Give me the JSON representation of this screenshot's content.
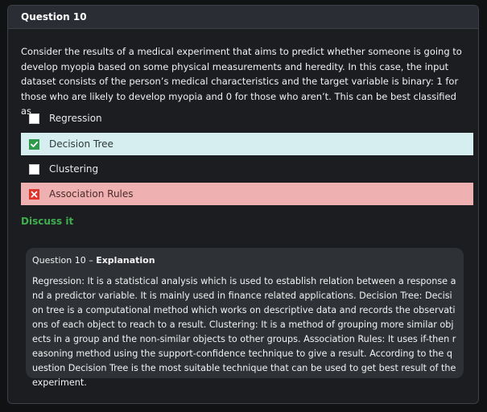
{
  "card": {
    "title": "Question 10"
  },
  "question": {
    "text": "Consider the results of a medical experiment that aims to predict whether someone is going to develop myopia based on some physical measurements and heredity. In this case, the input dataset consists of the person’s medical characteristics and the target variable is binary: 1 for those who are likely to develop myopia and 0 for those who aren’t. This can be best classified as"
  },
  "options": [
    {
      "label": "Regression",
      "state": "unselected"
    },
    {
      "label": "Decision Tree",
      "state": "correct"
    },
    {
      "label": "Clustering",
      "state": "unselected"
    },
    {
      "label": "Association Rules",
      "state": "wrong"
    }
  ],
  "discuss": {
    "label": "Discuss it"
  },
  "explanation": {
    "title_prefix": "Question 10 – ",
    "title_bold": "Explanation",
    "body": "Regression: It is a statistical analysis which is used to establish relation between a response and a predictor variable. It is mainly used in finance related applications. Decision Tree: Decision tree is a computational method which works on descriptive data and records the observations of each object to reach to a result. Clustering: It is a method of grouping more similar objects in a group and the non-similar objects to other groups. Association Rules: It uses if-then reasoning method using the support-confidence technique to give a result. According to the question Decision Tree is the most suitable technique that can be used to get best result of the experiment."
  },
  "colors": {
    "correct_bg": "#d6eef0",
    "wrong_bg": "#eeb0b0",
    "check_green": "#2f9a4c",
    "cross_red": "#e0352b",
    "discuss_green": "#3fae4f"
  }
}
